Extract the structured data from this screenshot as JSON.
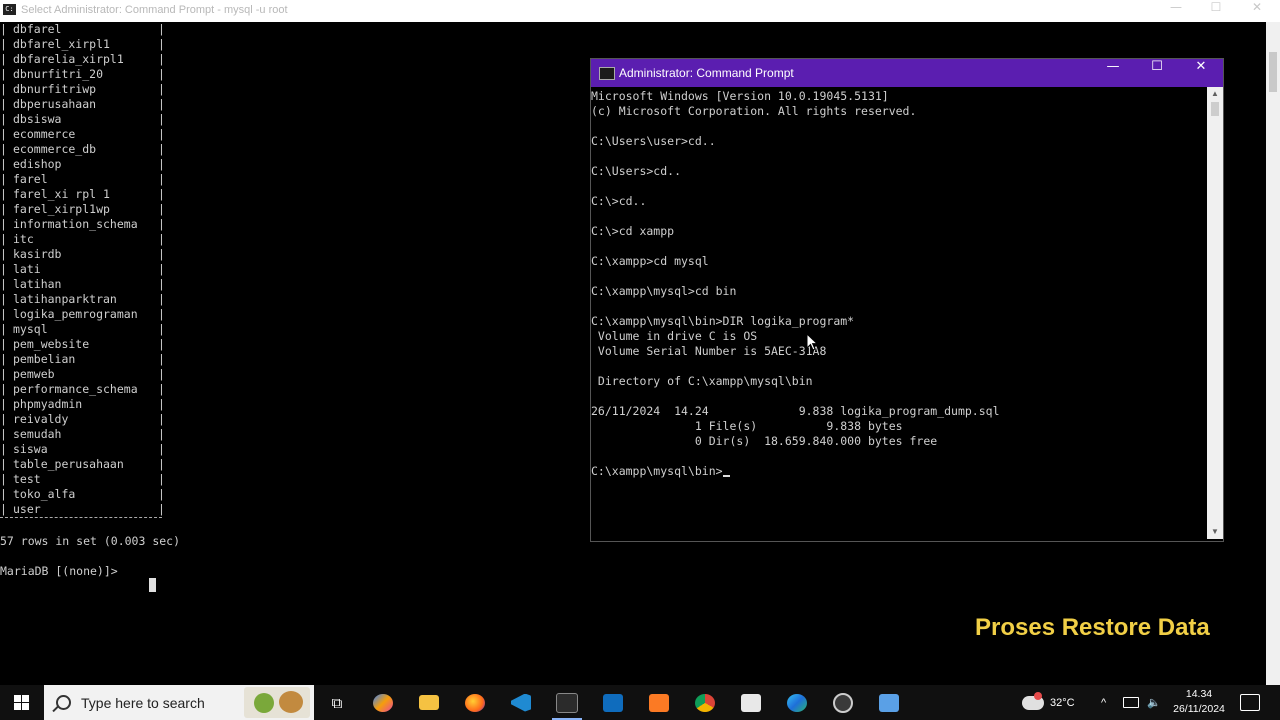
{
  "background_window": {
    "title": "Select Administrator: Command Prompt - mysql -u root",
    "icon": "cmd-icon",
    "controls": [
      "—",
      "☐",
      "✕"
    ],
    "databases": [
      "dbfarel",
      "dbfarel_xirpl1",
      "dbfarelia_xirpl1",
      "dbnurfitri_20",
      "dbnurfitriwp",
      "dbperusahaan",
      "dbsiswa",
      "ecommerce",
      "ecommerce_db",
      "edishop",
      "farel",
      "farel_xi rpl 1",
      "farel_xirpl1wp",
      "information_schema",
      "itc",
      "kasirdb",
      "lati",
      "latihan",
      "latihanparktran",
      "logika_pemrograman",
      "mysql",
      "pem_website",
      "pembelian",
      "pemweb",
      "performance_schema",
      "phpmyadmin",
      "reivaldy",
      "semudah",
      "siswa",
      "table_perusahaan",
      "test",
      "toko_alfa",
      "user"
    ],
    "separator": "+--------------------+",
    "rows_line": "57 rows in set (0.003 sec)",
    "prompt": "MariaDB [(none)]>"
  },
  "admin_window": {
    "title": "Administrator: Command Prompt",
    "icon": "cmd-icon",
    "controls": [
      "—",
      "☐",
      "✕"
    ],
    "lines": [
      "Microsoft Windows [Version 10.0.19045.5131]",
      "(c) Microsoft Corporation. All rights reserved.",
      "",
      "C:\\Users\\user>cd..",
      "",
      "C:\\Users>cd..",
      "",
      "C:\\>cd..",
      "",
      "C:\\>cd xampp",
      "",
      "C:\\xampp>cd mysql",
      "",
      "C:\\xampp\\mysql>cd bin",
      "",
      "C:\\xampp\\mysql\\bin>DIR logika_program*",
      " Volume in drive C is OS",
      " Volume Serial Number is 5AEC-31A8",
      "",
      " Directory of C:\\xampp\\mysql\\bin",
      "",
      "26/11/2024  14.24             9.838 logika_program_dump.sql",
      "               1 File(s)          9.838 bytes",
      "               0 Dir(s)  18.659.840.000 bytes free",
      "",
      "C:\\xampp\\mysql\\bin>"
    ]
  },
  "overlay_caption": "Proses Restore Data",
  "taskbar": {
    "search_placeholder": "Type here to search",
    "apps": [
      "task-view-icon",
      "copilot-icon",
      "file-explorer-icon",
      "firefox-icon",
      "vscode-icon",
      "terminal-icon",
      "outlook-icon",
      "xampp-icon",
      "chrome-icon",
      "store-icon",
      "edge-icon",
      "obs-icon",
      "app-icon"
    ],
    "temperature": "32°C",
    "time": "14.34",
    "date": "26/11/2024"
  },
  "colors": {
    "admin_titlebar": "#5b1eb0",
    "caption": "#f1cf46",
    "taskbar": "#101010"
  }
}
